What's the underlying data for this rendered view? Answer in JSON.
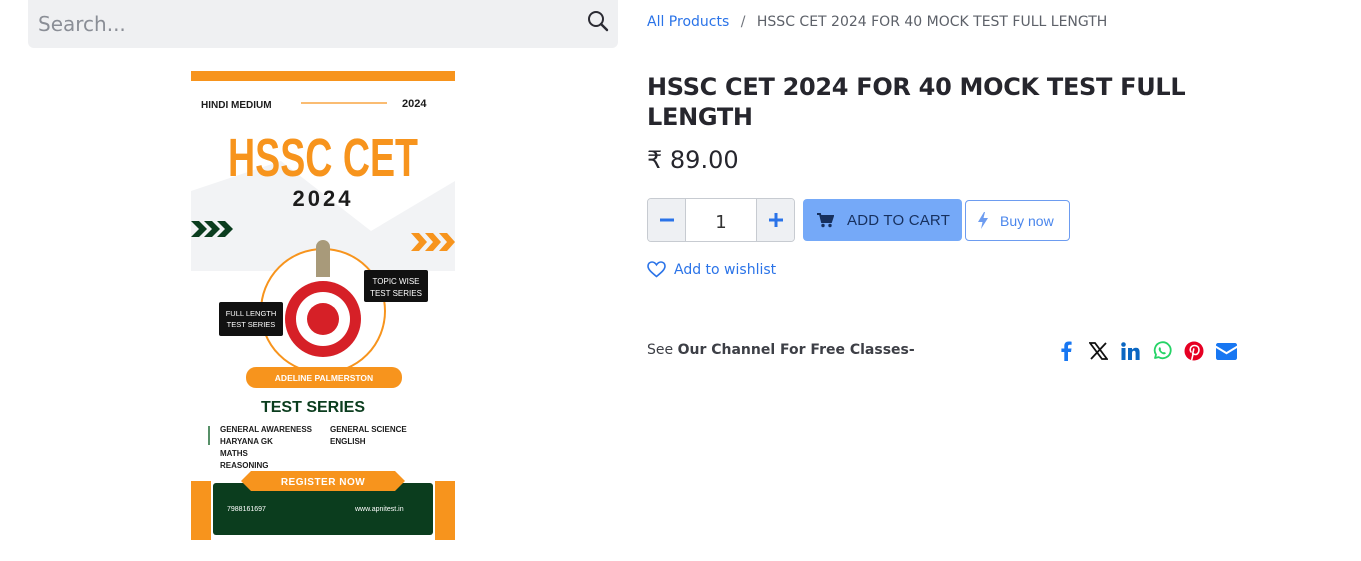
{
  "search": {
    "placeholder": "Search...",
    "value": ""
  },
  "breadcrumb": {
    "parent": "All Products",
    "separator": "/",
    "current": "HSSC CET 2024 FOR 40 MOCK TEST FULL LENGTH"
  },
  "product": {
    "title": "HSSC CET 2024 FOR 40 MOCK TEST FULL LENGTH",
    "price": "₹ 89.00",
    "quantity": "1"
  },
  "actions": {
    "add_to_cart": "ADD TO CART",
    "buy_now": "Buy now",
    "wishlist": "Add to wishlist"
  },
  "channel": {
    "prefix": "See",
    "text": "Our Channel For Free Classes-"
  },
  "share": {
    "icons": [
      "facebook-icon",
      "x-icon",
      "linkedin-icon",
      "whatsapp-icon",
      "pinterest-icon",
      "email-icon"
    ]
  },
  "poster": {
    "top_left": "HINDI MEDIUM",
    "top_right": "2024",
    "headline": "HSSC CET",
    "year": "2024",
    "badge_right_1": "TOPIC WISE",
    "badge_right_2": "TEST SERIES",
    "badge_left_1": "FULL LENGTH",
    "badge_left_2": "TEST SERIES",
    "author": "ADELINE PALMERSTON",
    "series_title": "TEST SERIES",
    "subjects_left": [
      "GENERAL AWARENESS",
      "HARYANA GK",
      "MATHS",
      "REASONING"
    ],
    "subjects_right": [
      "GENERAL SCIENCE",
      "ENGLISH"
    ],
    "cta": "REGISTER NOW",
    "phone": "7988161697",
    "website": "www.apnitest.in"
  },
  "colors": {
    "accent": "#2a73e8",
    "cart_button": "#75a9f8",
    "poster_orange": "#f7941d",
    "poster_green": "#0b3d1e",
    "facebook": "#1877f2",
    "linkedin": "#0a66c2",
    "whatsapp": "#25d366",
    "pinterest": "#e60023",
    "email": "#1877f2"
  }
}
